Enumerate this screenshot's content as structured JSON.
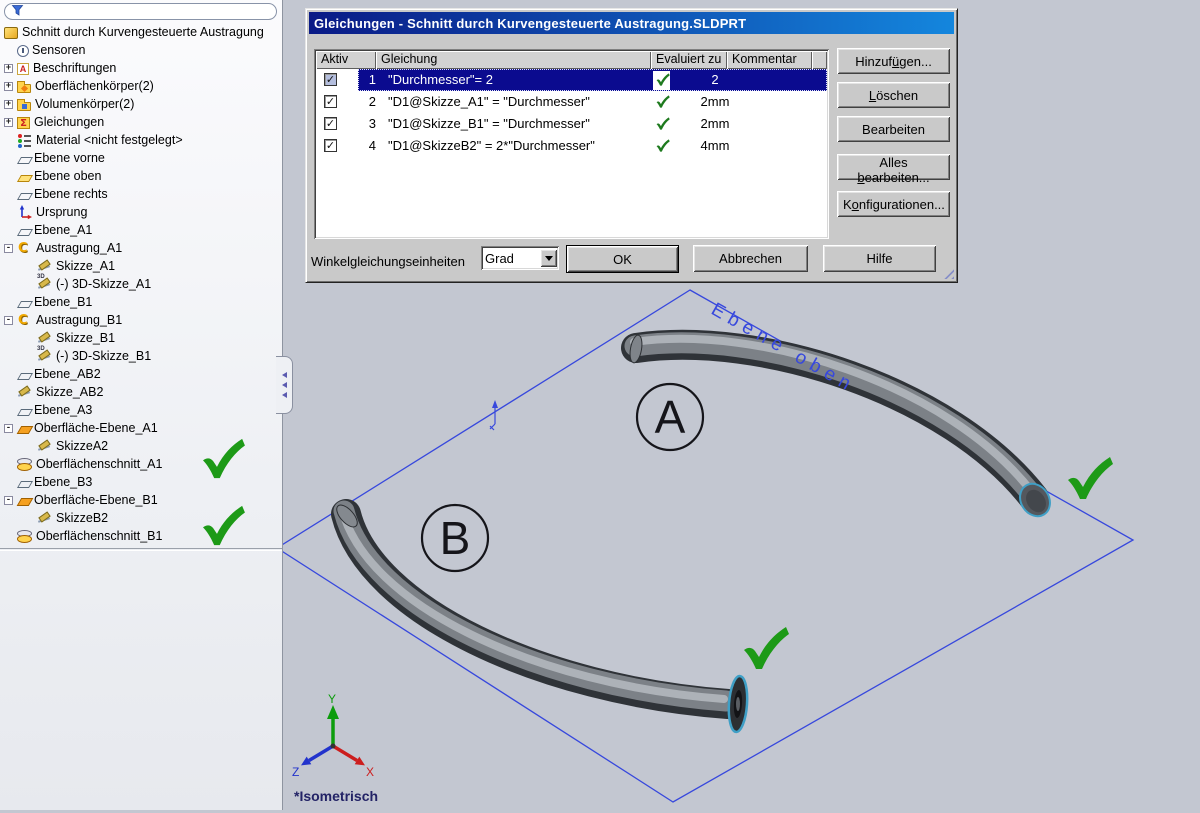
{
  "feature_tree": {
    "filter_placeholder": "",
    "items": [
      {
        "label": "Schnitt durch Kurvengesteuerte Austragung",
        "icon": "part-icon",
        "level": 0
      },
      {
        "label": "Sensoren",
        "icon": "sensors-icon",
        "level": 1
      },
      {
        "label": "Beschriftungen",
        "icon": "annotations-icon",
        "level": 1,
        "expand": "+"
      },
      {
        "label": "Oberflächenkörper(2)",
        "icon": "surface-folder-icon",
        "level": 1,
        "expand": "+"
      },
      {
        "label": "Volumenkörper(2)",
        "icon": "solid-folder-icon",
        "level": 1,
        "expand": "+"
      },
      {
        "label": "Gleichungen",
        "icon": "equations-icon",
        "level": 1,
        "expand": "+"
      },
      {
        "label": "Material <nicht festgelegt>",
        "icon": "material-icon",
        "level": 1
      },
      {
        "label": "Ebene vorne",
        "icon": "plane-icon",
        "level": 1
      },
      {
        "label": "Ebene oben",
        "icon": "plane-selected-icon",
        "level": 1
      },
      {
        "label": "Ebene rechts",
        "icon": "plane-icon",
        "level": 1
      },
      {
        "label": "Ursprung",
        "icon": "origin-icon",
        "level": 1
      },
      {
        "label": "Ebene_A1",
        "icon": "plane-icon",
        "level": 1
      },
      {
        "label": "Austragung_A1",
        "icon": "sweep-icon",
        "level": 1,
        "expand": "-"
      },
      {
        "label": "Skizze_A1",
        "icon": "sketch-icon",
        "level": 2
      },
      {
        "label": "(-) 3D-Skizze_A1",
        "icon": "sketch3d-icon",
        "level": 2
      },
      {
        "label": "Ebene_B1",
        "icon": "plane-icon",
        "level": 1
      },
      {
        "label": "Austragung_B1",
        "icon": "sweep-icon",
        "level": 1,
        "expand": "-"
      },
      {
        "label": "Skizze_B1",
        "icon": "sketch-icon",
        "level": 2
      },
      {
        "label": "(-) 3D-Skizze_B1",
        "icon": "sketch3d-icon",
        "level": 2
      },
      {
        "label": "Ebene_AB2",
        "icon": "plane-icon",
        "level": 1
      },
      {
        "label": "Skizze_AB2",
        "icon": "sketch-icon",
        "level": 1
      },
      {
        "label": "Ebene_A3",
        "icon": "plane-icon",
        "level": 1
      },
      {
        "label": "Oberfläche-Ebene_A1",
        "icon": "surface-plane-icon",
        "level": 1,
        "expand": "-"
      },
      {
        "label": "SkizzeA2",
        "icon": "sketch-icon",
        "level": 2
      },
      {
        "label": "Oberflächenschnitt_A1",
        "icon": "surface-cut-icon",
        "level": 1,
        "check": true
      },
      {
        "label": "Ebene_B3",
        "icon": "plane-icon",
        "level": 1
      },
      {
        "label": "Oberfläche-Ebene_B1",
        "icon": "surface-plane-icon",
        "level": 1,
        "expand": "-"
      },
      {
        "label": "SkizzeB2",
        "icon": "sketch-icon",
        "level": 2
      },
      {
        "label": "Oberflächenschnitt_B1",
        "icon": "surface-cut-icon",
        "level": 1,
        "check": true
      }
    ]
  },
  "dialog": {
    "title": "Gleichungen - Schnitt durch Kurvengesteuerte Austragung.SLDPRT",
    "columns": [
      "Aktiv",
      "Gleichung",
      "Evaluiert zu",
      "Kommentar"
    ],
    "rows": [
      {
        "num": "1",
        "equation": "\"Durchmesser\"= 2",
        "evaluated": "2",
        "comment": "",
        "active": true,
        "selected": true
      },
      {
        "num": "2",
        "equation": "\"D1@Skizze_A1\" = \"Durchmesser\"",
        "evaluated": "2mm",
        "comment": "",
        "active": true,
        "selected": false
      },
      {
        "num": "3",
        "equation": "\"D1@Skizze_B1\" = \"Durchmesser\"",
        "evaluated": "2mm",
        "comment": "",
        "active": true,
        "selected": false
      },
      {
        "num": "4",
        "equation": "\"D1@SkizzeB2\" = 2*\"Durchmesser\"",
        "evaluated": "4mm",
        "comment": "",
        "active": true,
        "selected": false
      }
    ],
    "side_buttons": [
      {
        "label": "Hinzufügen...",
        "u": 6
      },
      {
        "label": "Löschen",
        "u": 0
      },
      {
        "label": "Bearbeiten",
        "u": -1
      },
      {
        "label": "Alles bearbeiten...",
        "u": 6
      },
      {
        "label": "Konfigurationen...",
        "u": 1
      }
    ],
    "angle_units_label": "Winkelgleichungseinheiten",
    "angle_units_value": "Grad",
    "ok_label": "OK",
    "cancel_label": "Abbrechen",
    "help_label": "Hilfe"
  },
  "viewport": {
    "plane_label": "Ebene oben",
    "label_a": "A",
    "label_b": "B",
    "view_label": "*Isometrisch",
    "axis_x": "X",
    "axis_y": "Y",
    "axis_z": "Z",
    "colors": {
      "selection": "#0b0b8f",
      "check_green": "#1d9a17",
      "plane_blue": "#3748dd",
      "viewport_bg": "#c3c7d1",
      "titlebar_from": "#0a1a86",
      "titlebar_to": "#1486dd"
    }
  },
  "icons": {
    "filter-icon": "funnel",
    "check-icon": "green checkmark",
    "dropdown-arrow-icon": "black down triangle",
    "resize-grip-icon": "diagonal lines",
    "splitter-arrows-icon": "three left triangles"
  }
}
